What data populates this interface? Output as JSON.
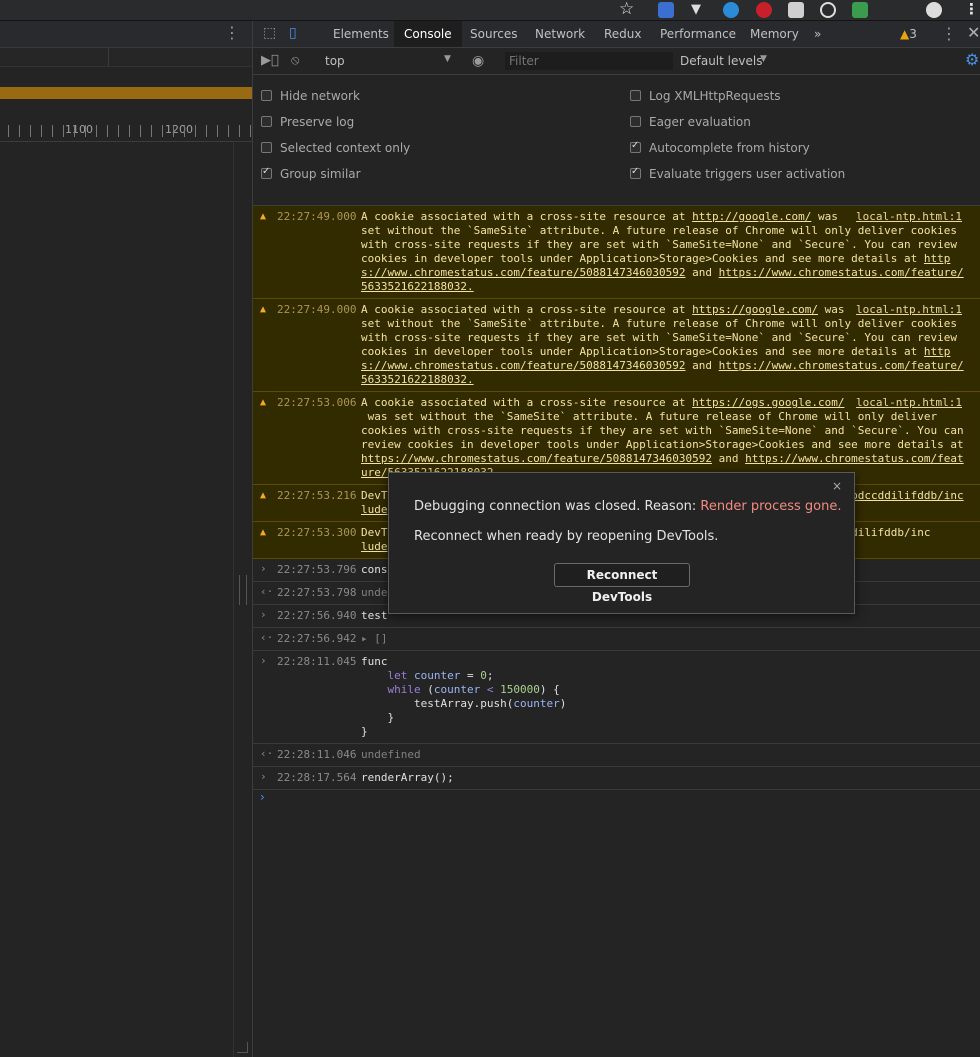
{
  "devtools": {
    "tabs": [
      "Elements",
      "Console",
      "Sources",
      "Network",
      "Redux",
      "Performance",
      "Memory"
    ],
    "active_tab": "Console",
    "more_tabs": "»",
    "warning_count": "3"
  },
  "console_toolbar": {
    "context": "top",
    "filter_placeholder": "Filter",
    "levels": "Default levels"
  },
  "settings": {
    "left": [
      {
        "label": "Hide network",
        "checked": false
      },
      {
        "label": "Preserve log",
        "checked": false
      },
      {
        "label": "Selected context only",
        "checked": false
      },
      {
        "label": "Group similar",
        "checked": true
      }
    ],
    "right": [
      {
        "label": "Log XMLHttpRequests",
        "checked": false
      },
      {
        "label": "Eager evaluation",
        "checked": false
      },
      {
        "label": "Autocomplete from history",
        "checked": true
      },
      {
        "label": "Evaluate triggers user activation",
        "checked": true
      }
    ]
  },
  "timeline": {
    "ruler_labels": [
      "1100",
      "1200"
    ]
  },
  "messages": [
    {
      "type": "warning",
      "time": "22:27:49.000",
      "source": "local-ntp.html:1",
      "lines": [
        "A cookie associated with a cross-site resource at http://google.com/ was",
        "set without the `SameSite` attribute. A future release of Chrome will only deliver cookies",
        "with cross-site requests if they are set with `SameSite=None` and `Secure`. You can review",
        "cookies in developer tools under Application>Storage>Cookies and see more details at http",
        "s://www.chromestatus.com/feature/5088147346030592 and https://www.chromestatus.com/feature/",
        "5633521622188032."
      ]
    },
    {
      "type": "warning",
      "time": "22:27:49.000",
      "source": "local-ntp.html:1",
      "lines": [
        "A cookie associated with a cross-site resource at https://google.com/ was",
        "set without the `SameSite` attribute. A future release of Chrome will only deliver cookies",
        "with cross-site requests if they are set with `SameSite=None` and `Secure`. You can review",
        "cookies in developer tools under Application>Storage>Cookies and see more details at http",
        "s://www.chromestatus.com/feature/5088147346030592 and https://www.chromestatus.com/feature/",
        "5633521622188032."
      ]
    },
    {
      "type": "warning",
      "time": "22:27:53.006",
      "source": "local-ntp.html:1",
      "lines": [
        "A cookie associated with a cross-site resource at https://ogs.google.com/",
        " was set without the `SameSite` attribute. A future release of Chrome will only deliver",
        "cookies with cross-site requests if they are set with `SameSite=None` and `Secure`. You can",
        "review cookies in developer tools under Application>Storage>Cookies and see more details at",
        "https://www.chromestatus.com/feature/5088147346030592 and https://www.chromestatus.com/feat",
        "ure/5633521622188032."
      ]
    },
    {
      "type": "warning",
      "time": "22:27:53.216",
      "source": "",
      "lines": [
        "DevTools failed to parse SourceMap: chrome-extension://cfhdojbkjhnklbpkdaibdccddilifddb/inc",
        "lude"
      ]
    },
    {
      "type": "warning",
      "time": "22:27:53.300",
      "source": "",
      "lines": [
        "DevT                                                                  dccddilifddb/inc",
        "lude"
      ]
    },
    {
      "type": "input",
      "time": "22:27:53.796",
      "lines": [
        "cons"
      ]
    },
    {
      "type": "result",
      "time": "22:27:53.798",
      "lines": [
        "unde"
      ]
    },
    {
      "type": "input",
      "time": "22:27:56.940",
      "lines": [
        "test"
      ]
    },
    {
      "type": "result",
      "time": "22:27:56.942",
      "lines": [
        "▸ []"
      ]
    },
    {
      "type": "input",
      "time": "22:28:11.045",
      "lines": [
        "func",
        "    let counter = 0;",
        "    while (counter < 150000) {",
        "        testArray.push(counter)",
        "    }",
        "}"
      ]
    },
    {
      "type": "result",
      "time": "22:28:11.046",
      "lines": [
        "undefined"
      ]
    },
    {
      "type": "input",
      "time": "22:28:17.564",
      "lines": [
        "renderArray();"
      ]
    }
  ],
  "dialog": {
    "close": "×",
    "line1_prefix": "Debugging connection was closed. Reason: ",
    "reason": "Render process gone.",
    "line2": "Reconnect when ready by reopening DevTools.",
    "button": "Reconnect DevTools"
  }
}
